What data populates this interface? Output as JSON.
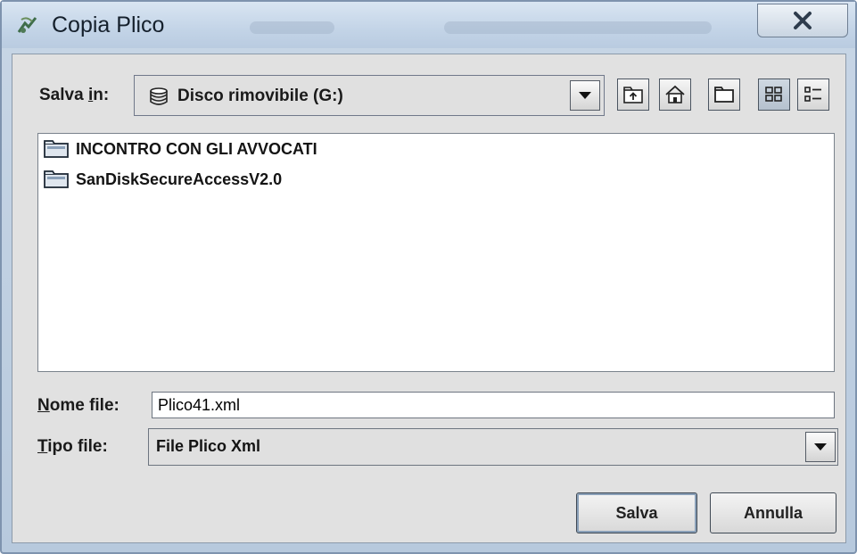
{
  "window": {
    "title": "Copia Plico",
    "close_symbol": "X",
    "accent_color": "#c3d4e7"
  },
  "toolbar": {
    "save_in_label_prefix": "Salva ",
    "save_in_label_mnemonic": "i",
    "save_in_label_suffix": "n:",
    "location": "Disco rimovibile (G:)",
    "location_icon": "disk-icon",
    "buttons": [
      "up-one-level-icon",
      "home-icon",
      "new-folder-icon",
      "list-view-icon",
      "details-view-icon"
    ]
  },
  "files": [
    {
      "name": "INCONTRO CON GLI AVVOCATI",
      "icon": "folder-icon"
    },
    {
      "name": "SanDiskSecureAccessV2.0",
      "icon": "folder-icon"
    }
  ],
  "filename": {
    "label_mnemonic": "N",
    "label_rest": "ome file:",
    "value": "Plico41.xml"
  },
  "filetype": {
    "label_mnemonic": "T",
    "label_rest": "ipo file:",
    "value": "File Plico Xml"
  },
  "actions": {
    "save": "Salva",
    "cancel": "Annulla"
  }
}
